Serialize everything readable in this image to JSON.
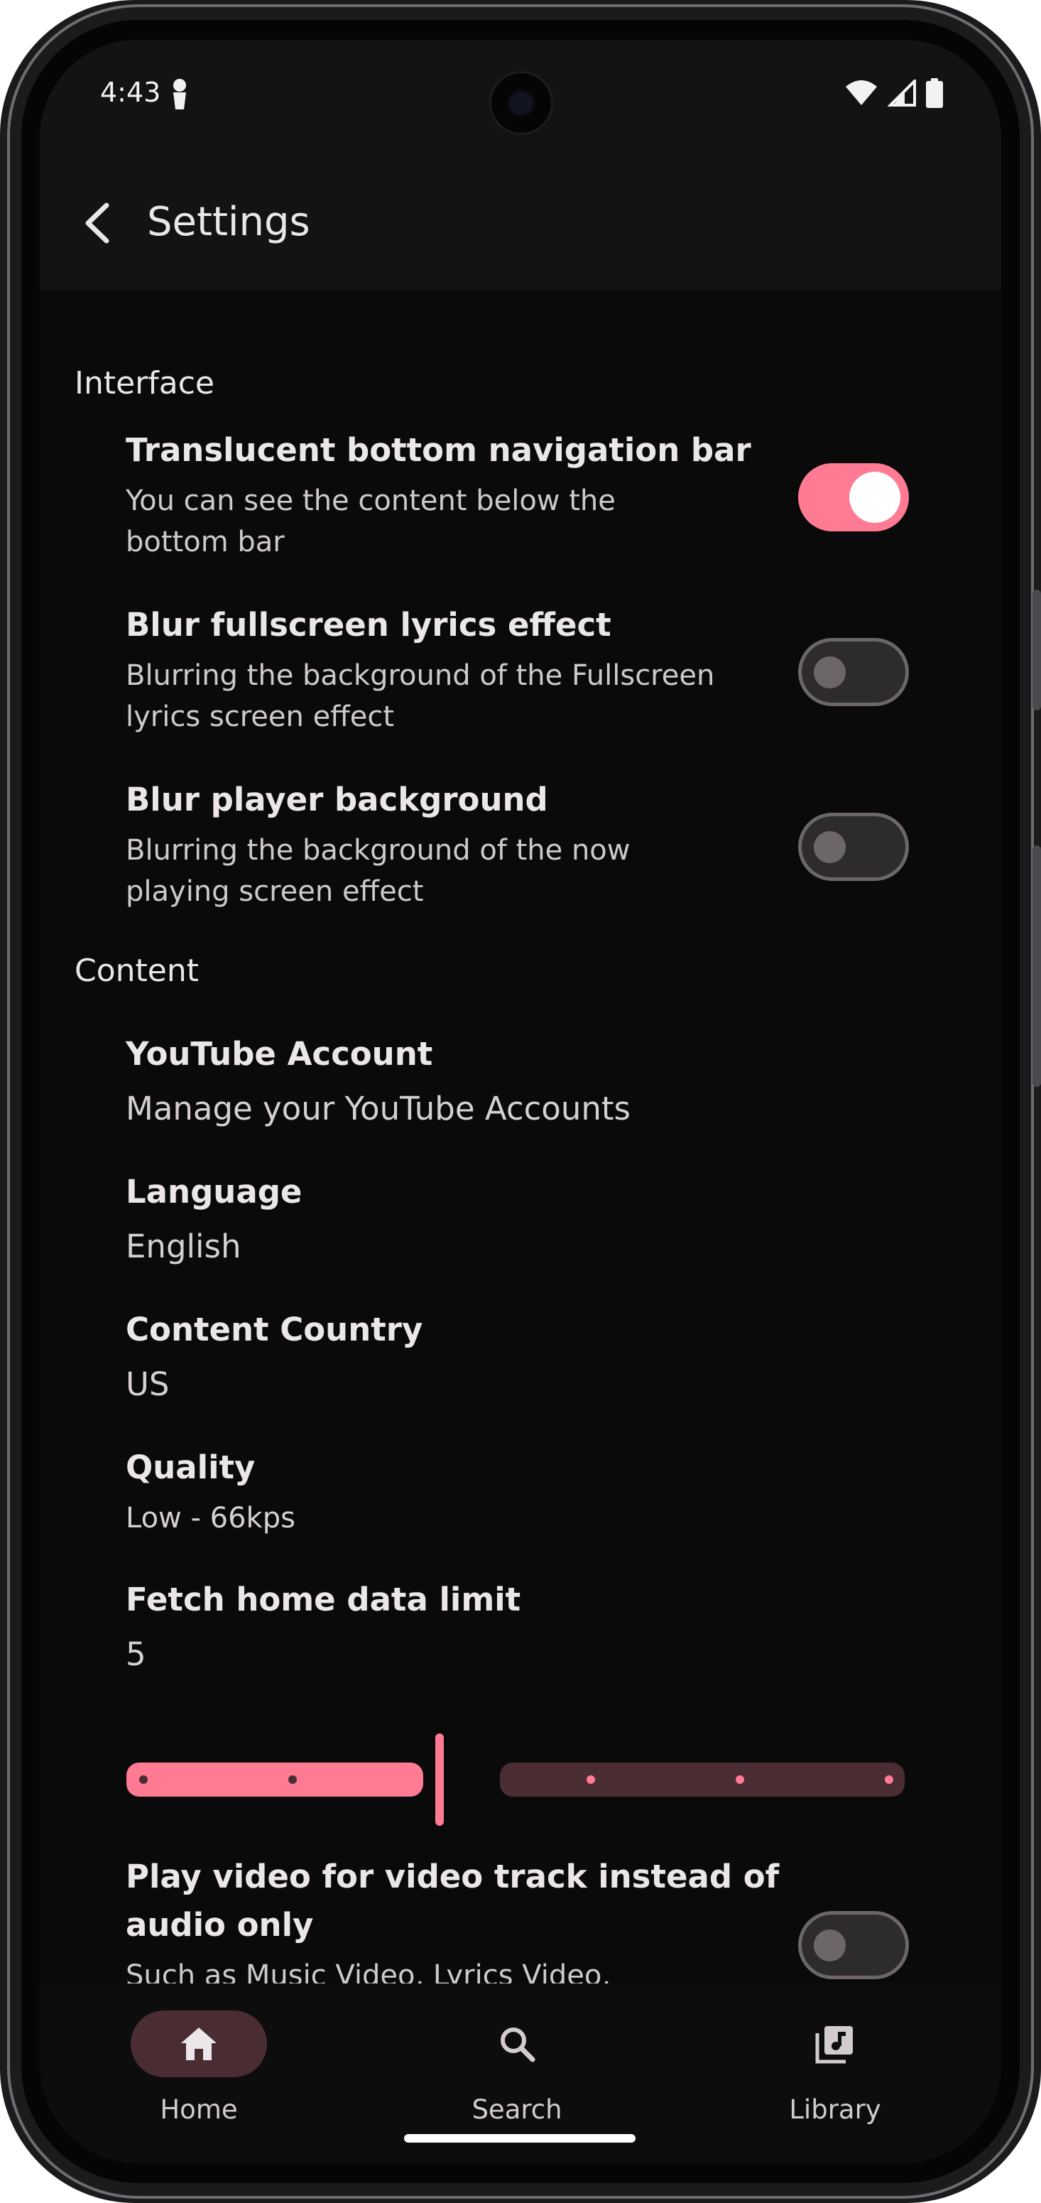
{
  "status_bar": {
    "time": "4:43"
  },
  "app_bar": {
    "title": "Settings"
  },
  "sections": {
    "interface": {
      "header": "Interface",
      "translucent": {
        "title": "Translucent bottom navigation bar",
        "sub1": "You can see the content below the",
        "sub2": "bottom bar",
        "enabled": true
      },
      "blur_lyrics": {
        "title": "Blur fullscreen lyrics effect",
        "sub1": "Blurring the background of the Fullscreen",
        "sub2": "lyrics screen effect",
        "enabled": false
      },
      "blur_player": {
        "title": "Blur player background",
        "sub1": "Blurring the background of the now",
        "sub2": "playing screen effect",
        "enabled": false
      }
    },
    "content": {
      "header": "Content",
      "youtube_account": {
        "title": "YouTube Account",
        "value": "Manage your YouTube Accounts"
      },
      "language": {
        "title": "Language",
        "value": "English"
      },
      "content_country": {
        "title": "Content Country",
        "value": "US"
      },
      "quality": {
        "title": "Quality",
        "value": "Low - 66kps"
      },
      "fetch_limit": {
        "title": "Fetch home data limit",
        "value": "5",
        "slider_fraction": 0.4
      },
      "play_video": {
        "title1": "Play video for video track instead of",
        "title2": "audio only",
        "sub1": "Such as Music Video, Lyrics Video,",
        "enabled": false
      }
    }
  },
  "bottom_nav": {
    "home": "Home",
    "search": "Search",
    "library": "Library",
    "active": "home"
  },
  "colors": {
    "accent": "#ff7a93",
    "background": "#0a0a0a",
    "active_pill": "#4a2c33"
  }
}
